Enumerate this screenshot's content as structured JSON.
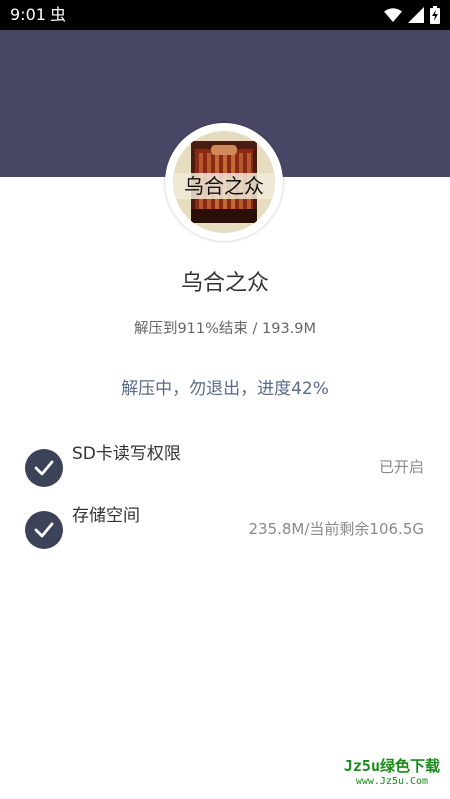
{
  "status_bar": {
    "time": "9:01",
    "notification_icon": "bug-icon",
    "notification_glyph": "虫",
    "right_icons": [
      "wifi-icon",
      "signal-icon",
      "battery-charging-icon"
    ]
  },
  "colors": {
    "header_background": "#484866",
    "check_badge": "#3c4257",
    "progress_text": "#5a6a8a",
    "watermark_green": "#1b8a1b"
  },
  "game": {
    "title": "乌合之众",
    "icon_text": "乌合之众",
    "extract_info": "解压到911%结束 / 193.9M",
    "progress_text": "解压中，勿退出，进度42%"
  },
  "checks": [
    {
      "label": "SD卡读写权限",
      "value": "已开启",
      "icon": "check-icon"
    },
    {
      "label": "存储空间",
      "value": "235.8M/当前剩余106.5G",
      "icon": "check-icon"
    }
  ],
  "watermark": {
    "main": "Jz5u绿色下载",
    "sub": "www.Jz5u.Com"
  }
}
